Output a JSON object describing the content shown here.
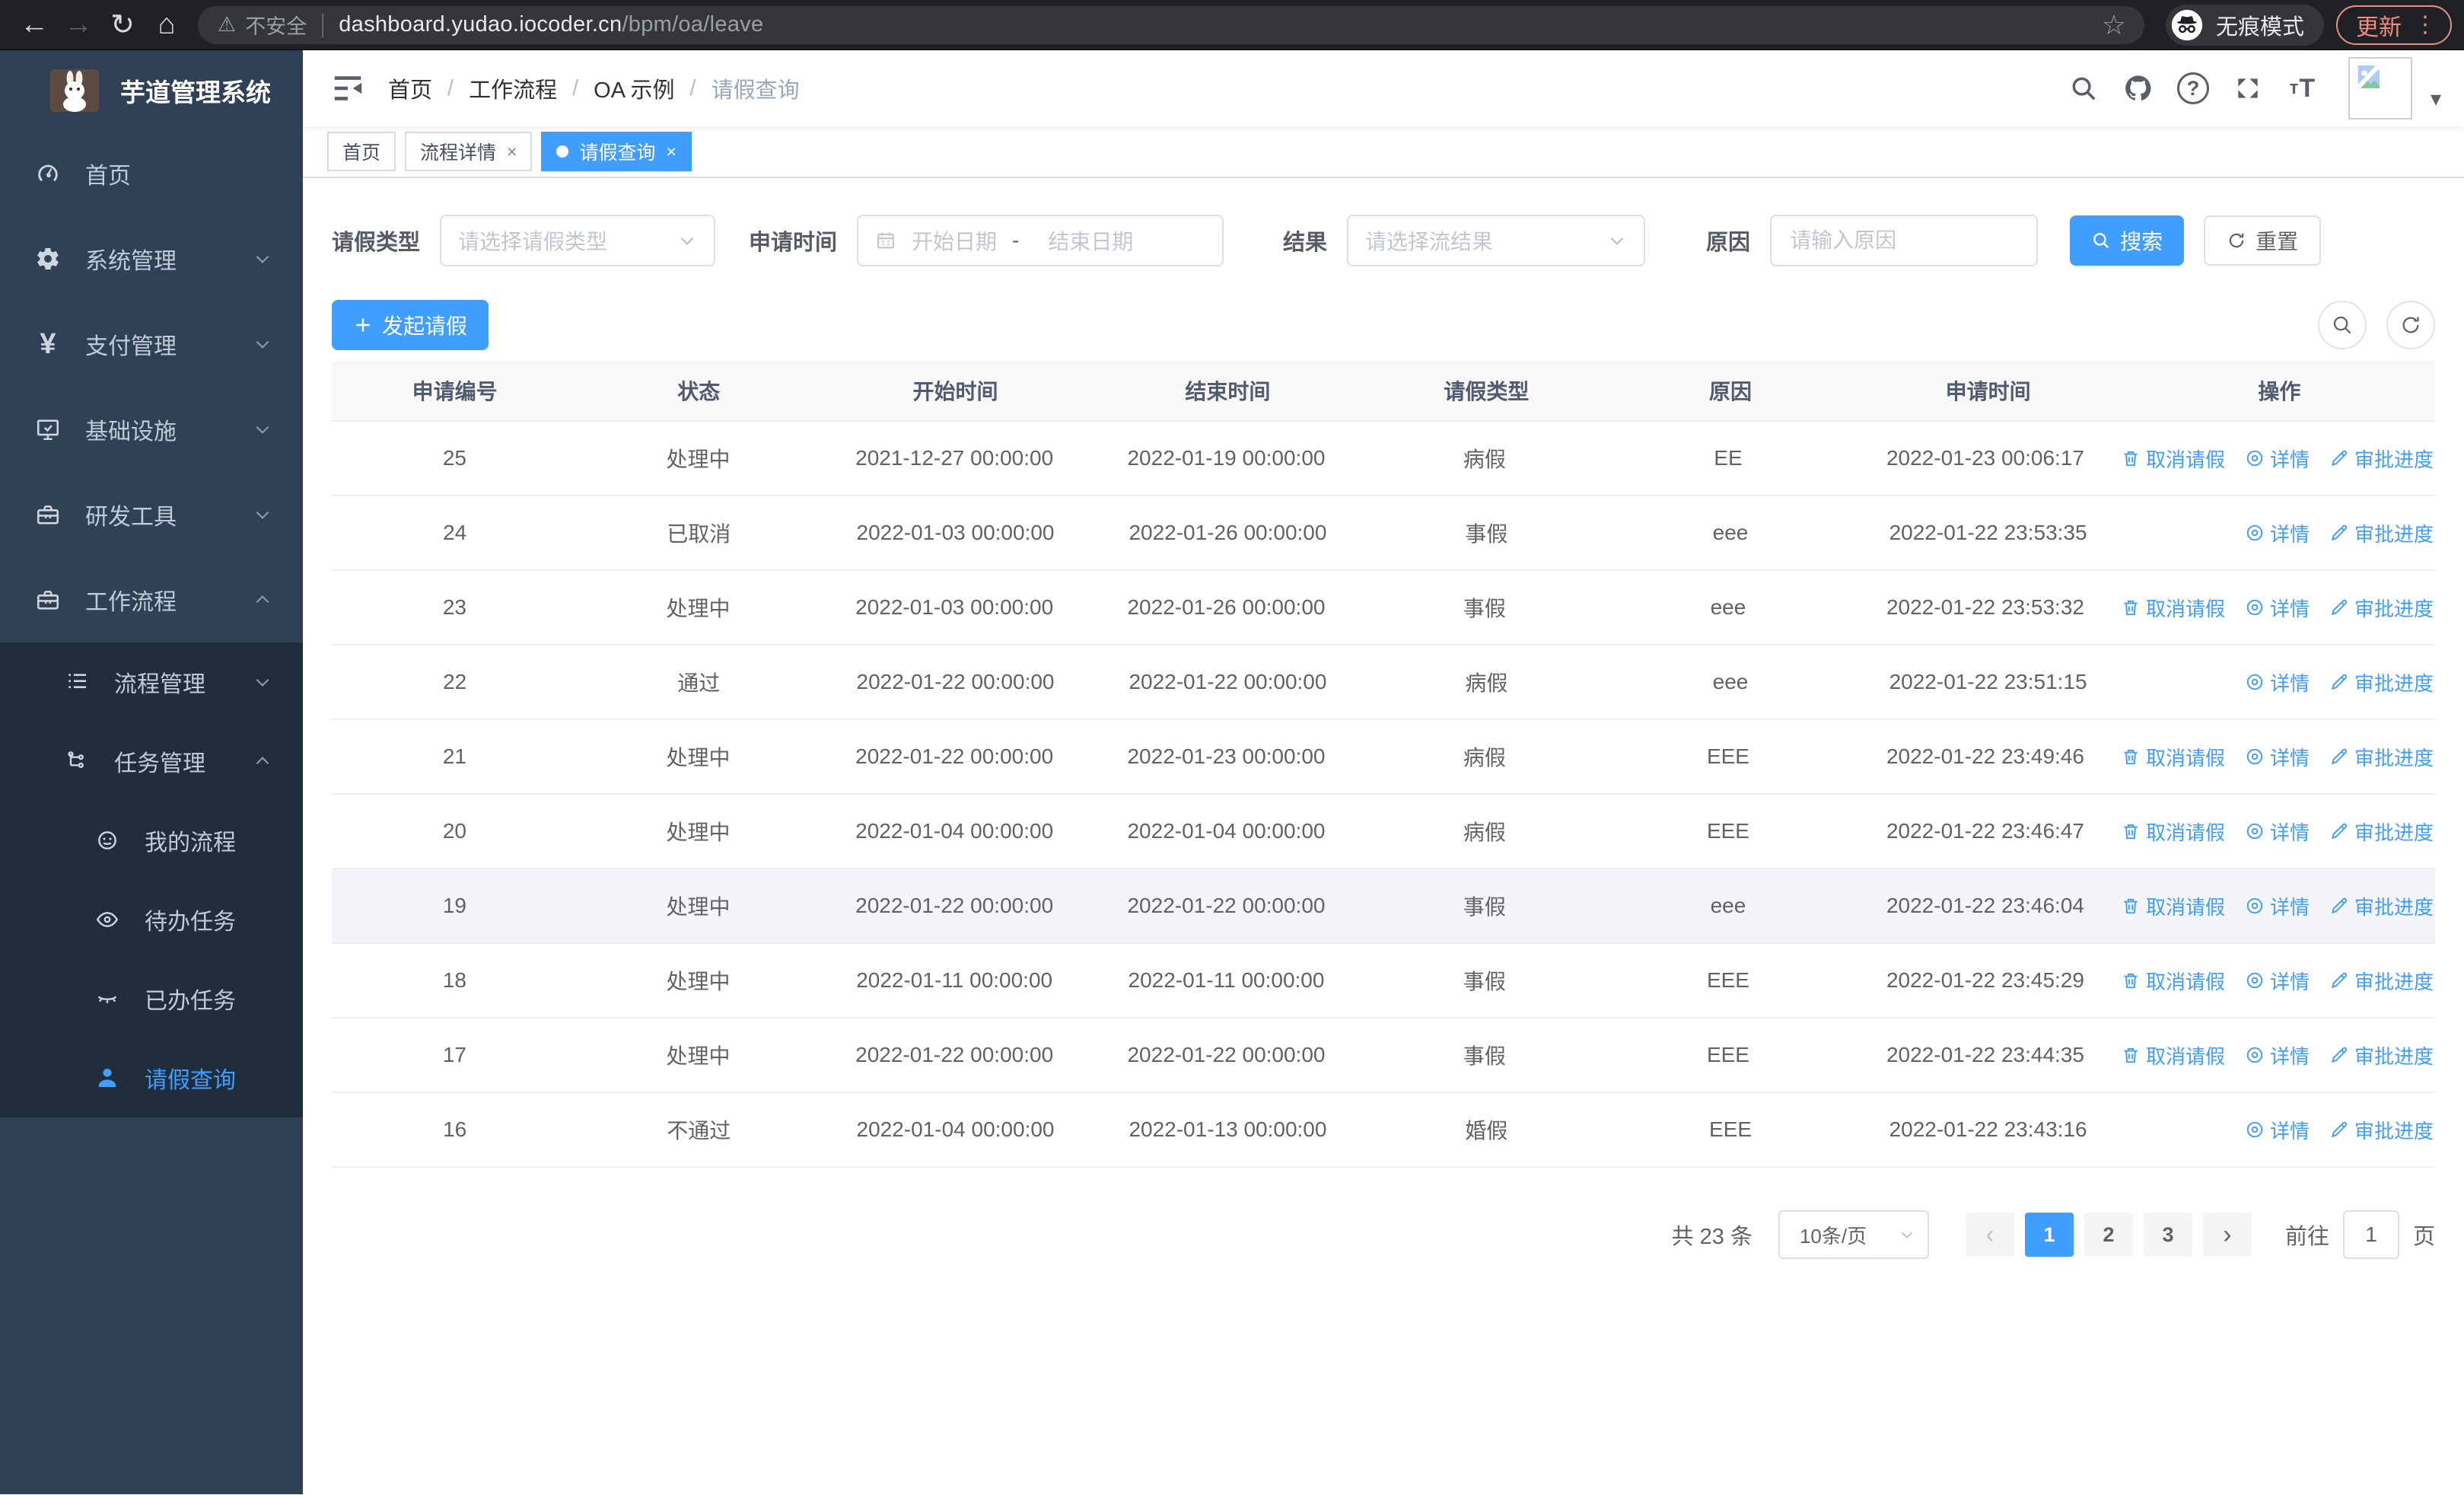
{
  "browser": {
    "security_label": "不安全",
    "url_host": "dashboard.yudao.iocoder.cn",
    "url_path": "/bpm/oa/leave",
    "incognito_label": "无痕模式",
    "update_label": "更新"
  },
  "icons": {
    "back": "←",
    "forward": "→",
    "reload": "↻",
    "home": "⌂",
    "warning": "⚠",
    "star": "☆",
    "menu_dots": "⋮",
    "caret_down": "▾",
    "prev": "‹",
    "next": "›",
    "plus": "＋",
    "font_small": "т",
    "font_big": "T",
    "question": "?"
  },
  "sidebar": {
    "brand": "芋道管理系统",
    "items": [
      {
        "label": "首页"
      },
      {
        "label": "系统管理"
      },
      {
        "label": "支付管理"
      },
      {
        "label": "基础设施"
      },
      {
        "label": "研发工具"
      },
      {
        "label": "工作流程"
      },
      {
        "label": "流程管理"
      },
      {
        "label": "任务管理"
      },
      {
        "label": "我的流程"
      },
      {
        "label": "待办任务"
      },
      {
        "label": "已办任务"
      },
      {
        "label": "请假查询"
      }
    ]
  },
  "breadcrumb": {
    "separator": "/",
    "items": [
      "首页",
      "工作流程",
      "OA 示例",
      "请假查询"
    ]
  },
  "tabs": {
    "close_glyph": "×",
    "items": [
      {
        "label": "首页",
        "closable": false,
        "active": false
      },
      {
        "label": "流程详情",
        "closable": true,
        "active": false
      },
      {
        "label": "请假查询",
        "closable": true,
        "active": true
      }
    ]
  },
  "filters": {
    "leave_type_label": "请假类型",
    "leave_type_placeholder": "请选择请假类型",
    "apply_time_label": "申请时间",
    "start_date_placeholder": "开始日期",
    "range_separator": "-",
    "end_date_placeholder": "结束日期",
    "result_label": "结果",
    "result_placeholder": "请选择流结果",
    "reason_label": "原因",
    "reason_placeholder": "请输入原因",
    "search_label": "搜索",
    "reset_label": "重置"
  },
  "toolbar": {
    "create_label": "发起请假"
  },
  "table": {
    "columns": [
      "申请编号",
      "状态",
      "开始时间",
      "结束时间",
      "请假类型",
      "原因",
      "申请时间",
      "操作"
    ],
    "action_labels": {
      "cancel": "取消请假",
      "detail": "详情",
      "progress": "审批进度"
    },
    "rows": [
      {
        "id": "25",
        "status": "处理中",
        "start": "2021-12-27 00:00:00",
        "end": "2022-01-19 00:00:00",
        "type": "病假",
        "reason": "EE",
        "applied": "2022-01-23 00:06:17",
        "actions": [
          "cancel",
          "detail",
          "progress"
        ],
        "highlight": false
      },
      {
        "id": "24",
        "status": "已取消",
        "start": "2022-01-03 00:00:00",
        "end": "2022-01-26 00:00:00",
        "type": "事假",
        "reason": "eee",
        "applied": "2022-01-22 23:53:35",
        "actions": [
          "detail",
          "progress"
        ],
        "highlight": false
      },
      {
        "id": "23",
        "status": "处理中",
        "start": "2022-01-03 00:00:00",
        "end": "2022-01-26 00:00:00",
        "type": "事假",
        "reason": "eee",
        "applied": "2022-01-22 23:53:32",
        "actions": [
          "cancel",
          "detail",
          "progress"
        ],
        "highlight": false
      },
      {
        "id": "22",
        "status": "通过",
        "start": "2022-01-22 00:00:00",
        "end": "2022-01-22 00:00:00",
        "type": "病假",
        "reason": "eee",
        "applied": "2022-01-22 23:51:15",
        "actions": [
          "detail",
          "progress"
        ],
        "highlight": false
      },
      {
        "id": "21",
        "status": "处理中",
        "start": "2022-01-22 00:00:00",
        "end": "2022-01-23 00:00:00",
        "type": "病假",
        "reason": "EEE",
        "applied": "2022-01-22 23:49:46",
        "actions": [
          "cancel",
          "detail",
          "progress"
        ],
        "highlight": false
      },
      {
        "id": "20",
        "status": "处理中",
        "start": "2022-01-04 00:00:00",
        "end": "2022-01-04 00:00:00",
        "type": "病假",
        "reason": "EEE",
        "applied": "2022-01-22 23:46:47",
        "actions": [
          "cancel",
          "detail",
          "progress"
        ],
        "highlight": false
      },
      {
        "id": "19",
        "status": "处理中",
        "start": "2022-01-22 00:00:00",
        "end": "2022-01-22 00:00:00",
        "type": "事假",
        "reason": "eee",
        "applied": "2022-01-22 23:46:04",
        "actions": [
          "cancel",
          "detail",
          "progress"
        ],
        "highlight": true
      },
      {
        "id": "18",
        "status": "处理中",
        "start": "2022-01-11 00:00:00",
        "end": "2022-01-11 00:00:00",
        "type": "事假",
        "reason": "EEE",
        "applied": "2022-01-22 23:45:29",
        "actions": [
          "cancel",
          "detail",
          "progress"
        ],
        "highlight": false
      },
      {
        "id": "17",
        "status": "处理中",
        "start": "2022-01-22 00:00:00",
        "end": "2022-01-22 00:00:00",
        "type": "事假",
        "reason": "EEE",
        "applied": "2022-01-22 23:44:35",
        "actions": [
          "cancel",
          "detail",
          "progress"
        ],
        "highlight": false
      },
      {
        "id": "16",
        "status": "不通过",
        "start": "2022-01-04 00:00:00",
        "end": "2022-01-13 00:00:00",
        "type": "婚假",
        "reason": "EEE",
        "applied": "2022-01-22 23:43:16",
        "actions": [
          "detail",
          "progress"
        ],
        "highlight": false
      }
    ]
  },
  "pagination": {
    "total_label": "共 23 条",
    "page_size_label": "10条/页",
    "pages": [
      "1",
      "2",
      "3"
    ],
    "active_page": "1",
    "goto_label": "前往",
    "goto_value": "1",
    "unit_label": "页"
  },
  "colors": {
    "primary": "#409eff",
    "sidebar_bg": "#304156",
    "submenu_bg": "#1f2d3d",
    "update_accent": "#ee8d80"
  }
}
